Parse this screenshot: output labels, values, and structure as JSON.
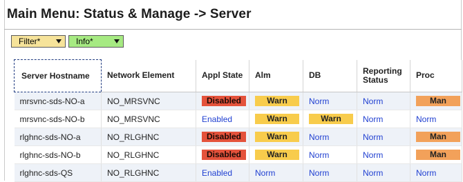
{
  "title": "Main Menu: Status & Manage -> Server",
  "toolbar": {
    "filter_label": "Filter*",
    "info_label": "Info*"
  },
  "columns": [
    "Server Hostname",
    "Network Element",
    "Appl State",
    "Alm",
    "DB",
    "Reporting Status",
    "Proc"
  ],
  "rows": [
    {
      "hostname": "mrsvnc-sds-NO-a",
      "ne": "NO_MRSVNC",
      "appl": "Disabled",
      "alm": "Warn",
      "db": "Norm",
      "rep": "Norm",
      "proc": "Man"
    },
    {
      "hostname": "mrsvnc-sds-NO-b",
      "ne": "NO_MRSVNC",
      "appl": "Enabled",
      "alm": "Warn",
      "db": "Warn",
      "rep": "Norm",
      "proc": "Norm"
    },
    {
      "hostname": "rlghnc-sds-NO-a",
      "ne": "NO_RLGHNC",
      "appl": "Disabled",
      "alm": "Warn",
      "db": "Norm",
      "rep": "Norm",
      "proc": "Man"
    },
    {
      "hostname": "rlghnc-sds-NO-b",
      "ne": "NO_RLGHNC",
      "appl": "Disabled",
      "alm": "Warn",
      "db": "Norm",
      "rep": "Norm",
      "proc": "Man"
    },
    {
      "hostname": "rlghnc-sds-QS",
      "ne": "NO_RLGHNC",
      "appl": "Enabled",
      "alm": "Norm",
      "db": "Norm",
      "rep": "Norm",
      "proc": "Norm"
    }
  ],
  "colors": {
    "disabled": "#e4523b",
    "warn": "#f8cc4c",
    "man": "#f2a15a",
    "norm_text": "#1f3fd1",
    "filter_bg": "#f6e39a",
    "info_bg": "#a6ea82"
  }
}
